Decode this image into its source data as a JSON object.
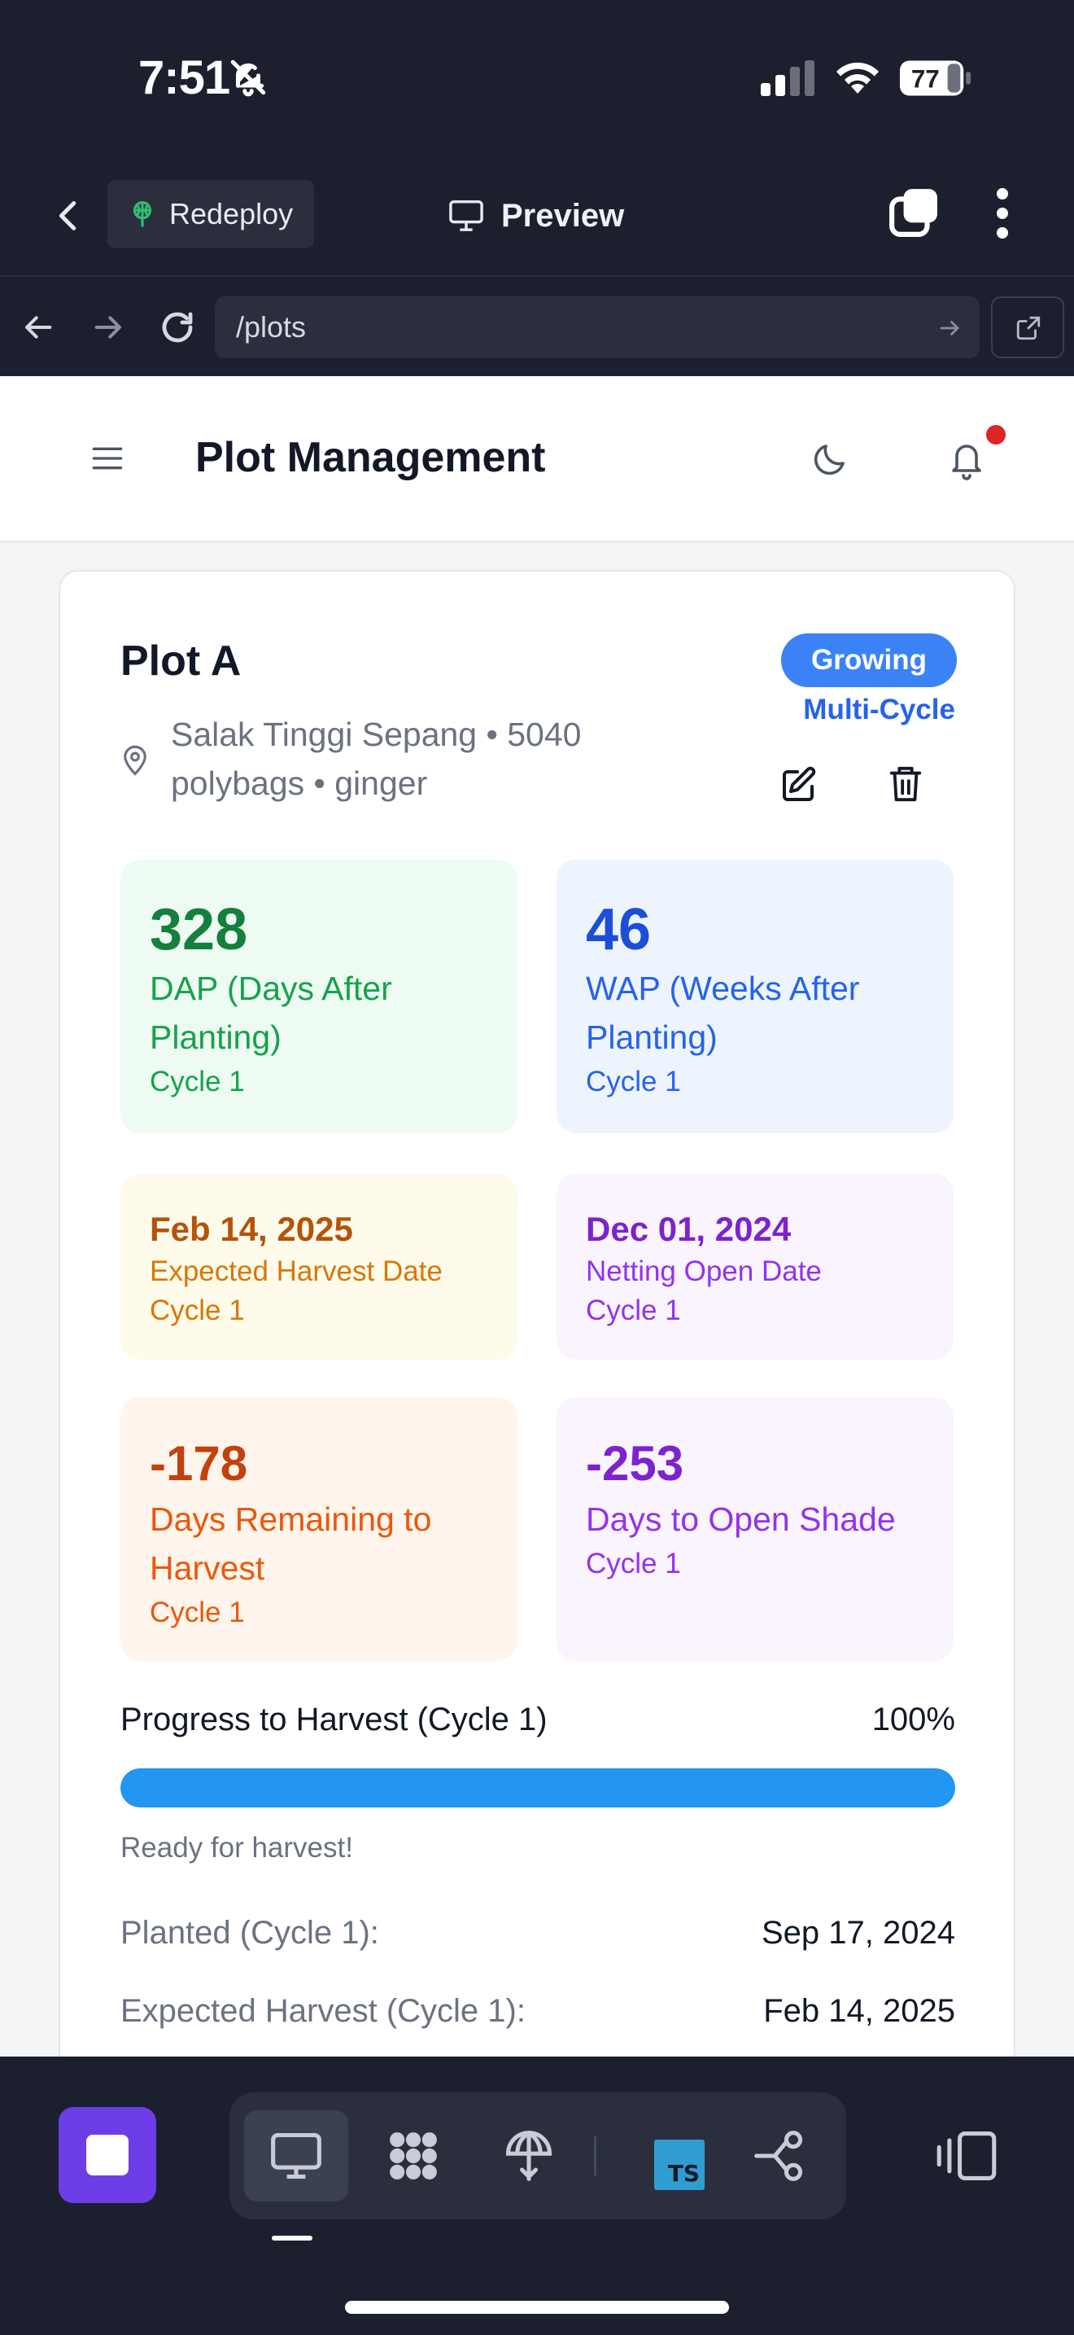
{
  "status_bar": {
    "time": "7:51",
    "battery": "77"
  },
  "replit_bar": {
    "redeploy_label": "Redeploy",
    "preview_label": "Preview"
  },
  "url_bar": {
    "url": "/plots"
  },
  "app_header": {
    "title": "Plot Management"
  },
  "plot": {
    "name": "Plot A",
    "meta_line1": "Salak Tinggi Sepang • 5040",
    "meta_line2": "polybags • ginger",
    "status": "Growing",
    "cycle_type": "Multi-Cycle"
  },
  "stats": {
    "dap": {
      "value": "328",
      "label_line1": "DAP (Days After",
      "label_line2": "Planting)",
      "cycle": "Cycle 1"
    },
    "wap": {
      "value": "46",
      "label_line1": "WAP (Weeks After",
      "label_line2": "Planting)",
      "cycle": "Cycle 1"
    },
    "harvest_date": {
      "date": "Feb 14, 2025",
      "label": "Expected Harvest Date",
      "cycle": "Cycle 1"
    },
    "netting_date": {
      "date": "Dec 01, 2024",
      "label": "Netting Open Date",
      "cycle": "Cycle 1"
    },
    "days_remaining": {
      "value": "-178",
      "label_line1": "Days Remaining to",
      "label_line2": "Harvest",
      "cycle": "Cycle 1"
    },
    "days_shade": {
      "value": "-253",
      "label": "Days to Open Shade",
      "cycle": "Cycle 1"
    }
  },
  "progress": {
    "label": "Progress to Harvest (Cycle 1)",
    "percent_text": "100%",
    "fraction": 1.0,
    "message": "Ready for harvest!",
    "accent": "#2196f3"
  },
  "details": [
    {
      "label": "Planted (Cycle 1):",
      "value": "Sep 17, 2024"
    },
    {
      "label": "Expected Harvest (Cycle 1):",
      "value": "Feb 14, 2025"
    }
  ],
  "bottom_toolbar": {
    "ts_badge": "TS",
    "icons": [
      "monitor-icon",
      "packages-icon",
      "deploy-icon",
      "typescript-icon",
      "git-branch-icon",
      "side-panel-icon"
    ]
  },
  "colors": {
    "status_pill": "#3b82f6",
    "stop_button": "#6d3de8",
    "notification_dot": "#dc2626"
  }
}
